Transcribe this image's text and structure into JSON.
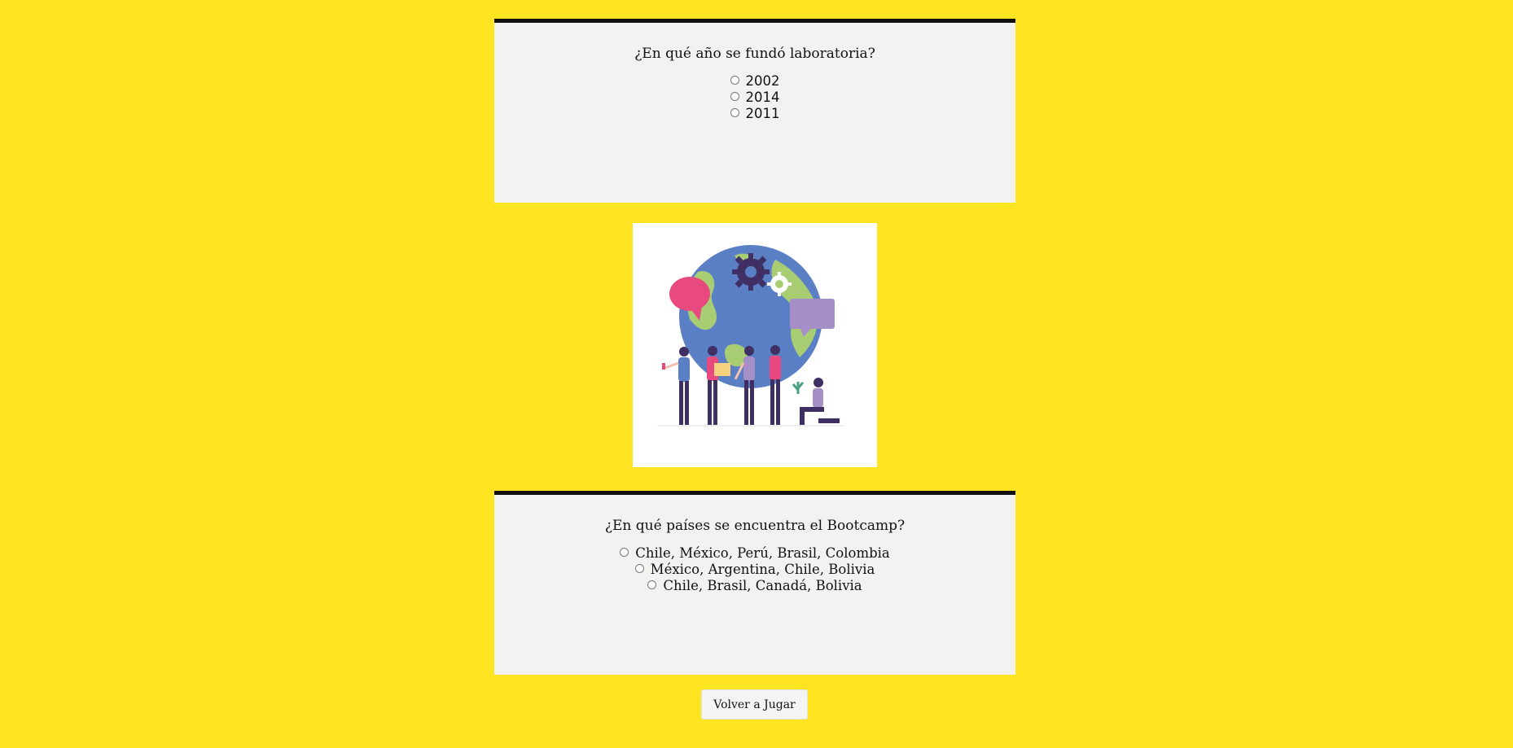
{
  "quiz": {
    "questions": [
      {
        "text": "¿En qué año se fundó laboratoria?",
        "options": [
          "2002",
          "2014",
          "2011"
        ]
      },
      {
        "text": "¿En qué países se encuentra el Bootcamp?",
        "options": [
          "Chile, México, Perú, Brasil, Colombia",
          "México, Argentina, Chile, Bolivia",
          "Chile, Brasil, Canadá, Bolivia"
        ]
      }
    ],
    "replay_label": "Volver a Jugar"
  },
  "colors": {
    "background": "#ffe521",
    "card": "#f2f2f0",
    "card_border": "#111111",
    "globe_ocean": "#5b7fc4",
    "globe_land": "#a9cd73",
    "gear": "#3f2f63",
    "bubble_pink": "#e84a7f",
    "bubble_lilac": "#a68fc6"
  },
  "illustration": {
    "icon": "teamwork-globe-illustration"
  }
}
